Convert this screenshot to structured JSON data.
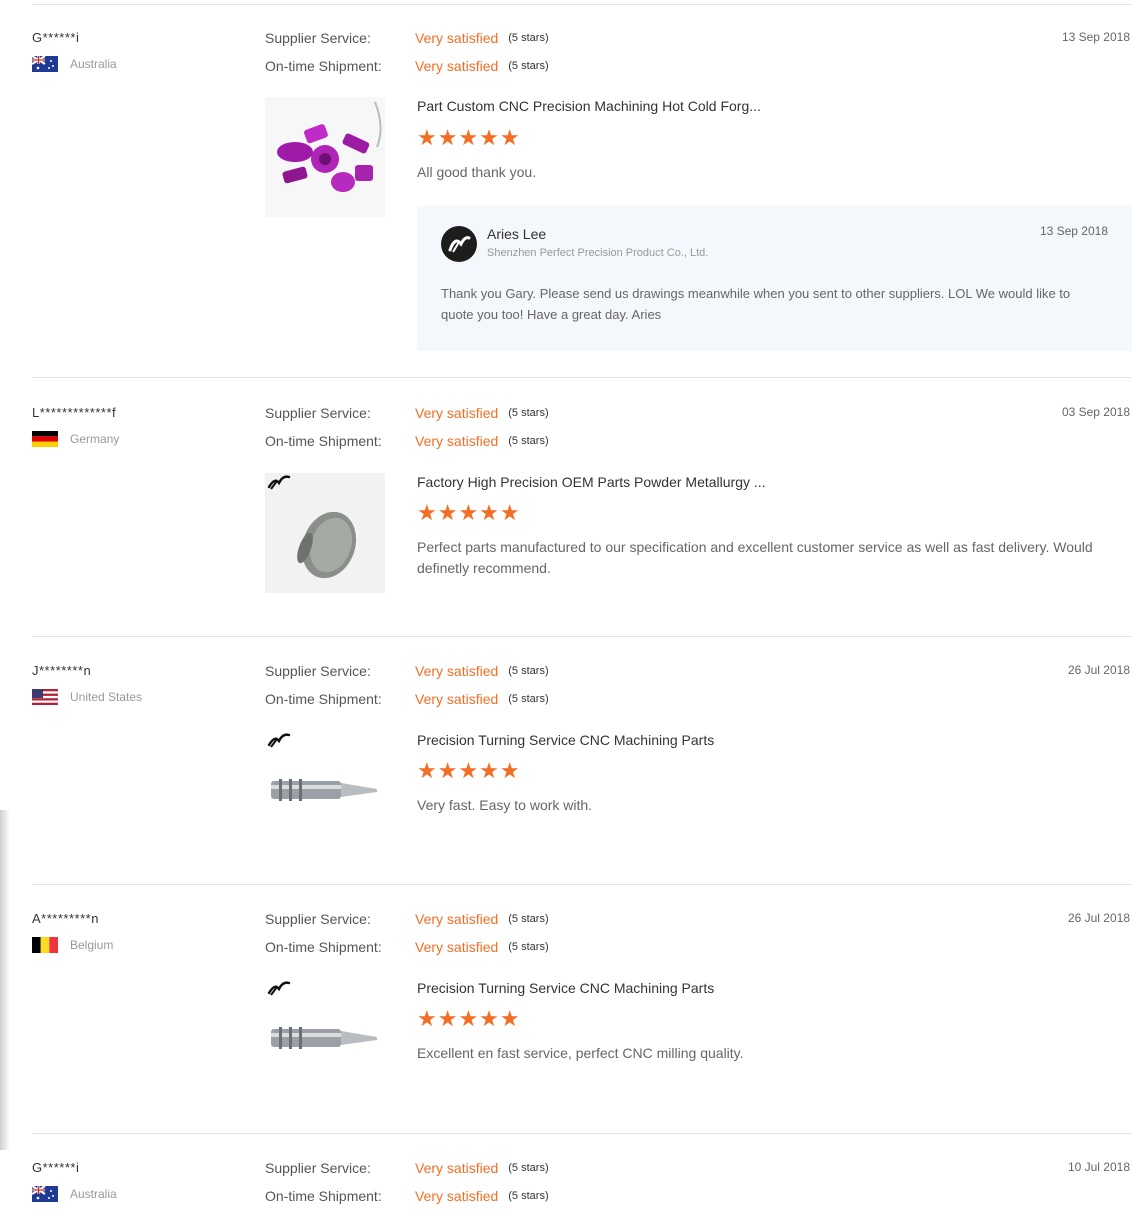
{
  "labels": {
    "supplier_service": "Supplier Service:",
    "on_time_shipment": "On-time Shipment:",
    "satisfaction": "Very satisfied",
    "stars_text": "(5 stars)"
  },
  "colors": {
    "accent": "#f36e24",
    "divider": "#e4e4e4",
    "reply_bg": "#f4f7fb"
  },
  "reviews": [
    {
      "buyer": "G******i",
      "country": "Australia",
      "flag": "australia",
      "date": "13 Sep 2018",
      "product_title": "Part Custom CNC Precision Machining Hot Cold Forg...",
      "stars": "★★★★★",
      "rating": 5,
      "comment": "All good thank you.",
      "reply": {
        "name": "Aries Lee",
        "company": "Shenzhen Perfect Precision Product Co., Ltd.",
        "date": "13 Sep 2018",
        "text": "Thank you Gary. Please send us drawings meanwhile when you sent to other suppliers. LOL We would like to quote you too! Have a great day. Aries"
      }
    },
    {
      "buyer": "L*************f",
      "country": "Germany",
      "flag": "germany",
      "date": "03 Sep 2018",
      "product_title": "Factory High Precision OEM Parts Powder Metallurgy ...",
      "stars": "★★★★★",
      "rating": 5,
      "comment": "Perfect parts manufactured to our specification and excellent customer service as well as fast delivery. Would definetly recommend."
    },
    {
      "buyer": "J********n",
      "country": "United States",
      "flag": "usa",
      "date": "26 Jul 2018",
      "product_title": "Precision Turning Service CNC Machining Parts",
      "stars": "★★★★★",
      "rating": 5,
      "comment": "Very fast. Easy to work with."
    },
    {
      "buyer": "A*********n",
      "country": "Belgium",
      "flag": "belgium",
      "date": "26 Jul 2018",
      "product_title": "Precision Turning Service CNC Machining Parts",
      "stars": "★★★★★",
      "rating": 5,
      "comment": "Excellent en fast service, perfect CNC milling quality."
    },
    {
      "buyer": "G******i",
      "country": "Australia",
      "flag": "australia",
      "date": "10 Jul 2018"
    }
  ]
}
